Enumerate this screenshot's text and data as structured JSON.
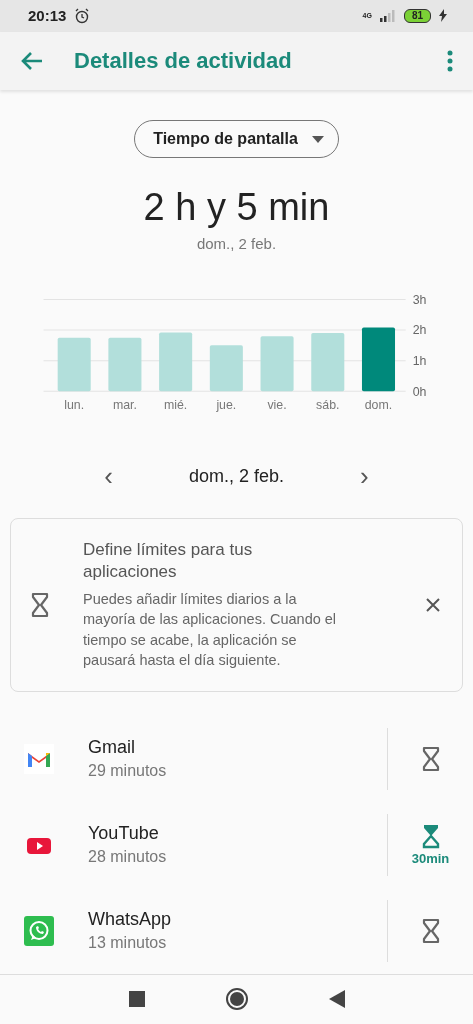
{
  "status_bar": {
    "time": "20:13",
    "network": "4G",
    "battery": "81"
  },
  "app_bar": {
    "title": "Detalles de actividad"
  },
  "dropdown": {
    "value": "Tiempo de pantalla"
  },
  "summary": {
    "total": "2 h y 5 min",
    "date": "dom., 2 feb."
  },
  "chart_data": {
    "type": "bar",
    "categories": [
      "lun.",
      "mar.",
      "mié.",
      "jue.",
      "vie.",
      "sáb.",
      "dom."
    ],
    "series": [
      {
        "color": "#b2dfdb",
        "values": [
          1.75,
          1.75,
          1.92,
          1.5,
          1.8,
          1.9,
          null
        ]
      },
      {
        "color": "#00897b",
        "values": [
          null,
          null,
          null,
          null,
          null,
          null,
          2.08
        ]
      }
    ],
    "stacked": true,
    "ylim": [
      0,
      3
    ],
    "yticks": [
      {
        "value": 0,
        "label": "0h"
      },
      {
        "value": 1,
        "label": "1h"
      },
      {
        "value": 2,
        "label": "2h"
      },
      {
        "value": 3,
        "label": "3h"
      }
    ]
  },
  "date_nav": {
    "prev": "‹",
    "date": "dom., 2 feb.",
    "next": "›"
  },
  "tip_card": {
    "title": "Define límites para tus aplicaciones",
    "body": "Puedes añadir límites diarios a la mayoría de las aplicaciones. Cuando el tiempo se acabe, la aplicación se pausará hasta el día siguiente."
  },
  "apps": [
    {
      "kind": "gmail",
      "name": "Gmail",
      "usage": "29 minutos",
      "timer_on": false
    },
    {
      "kind": "youtube",
      "name": "YouTube",
      "usage": "28 minutos",
      "timer_on": true,
      "limit": "30min"
    },
    {
      "kind": "whatsapp",
      "name": "WhatsApp",
      "usage": "13 minutos",
      "timer_on": false
    }
  ]
}
